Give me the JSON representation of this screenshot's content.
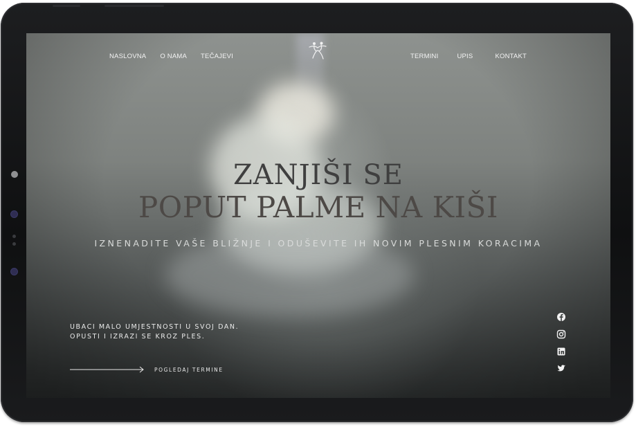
{
  "nav": {
    "left": [
      "NASLOVNA",
      "O NAMA",
      "TEČAJEVI"
    ],
    "right": [
      "TERMINI",
      "UPIS",
      "KONTAKT"
    ]
  },
  "logo": {
    "icon": "dancing-couple-icon"
  },
  "hero": {
    "title_line1": "ZANJIŠI SE",
    "title_line2": "POPUT PALME NA KIŠI",
    "subtitle": "IZNENADITE VAŠE BLIŽNJE I ODUŠEVITE IH NOVIM PLESNIM KORACIMA"
  },
  "tagline": {
    "line1": "UBACI MALO UMJESTNOSTI U SVOJ DAN.",
    "line2": "OPUSTI I IZRAZI SE KROZ PLES."
  },
  "cta": {
    "label": "POGLEDAJ TERMINE",
    "icon": "arrow-right-icon"
  },
  "social": [
    "facebook-icon",
    "instagram-icon",
    "linkedin-icon",
    "twitter-icon"
  ],
  "colors": {
    "bezel": "#141516",
    "screen_top": "#8e928f",
    "screen_bottom": "#2b2e2e",
    "title": "#4a4a4a",
    "light_text": "#f3f3f3"
  }
}
